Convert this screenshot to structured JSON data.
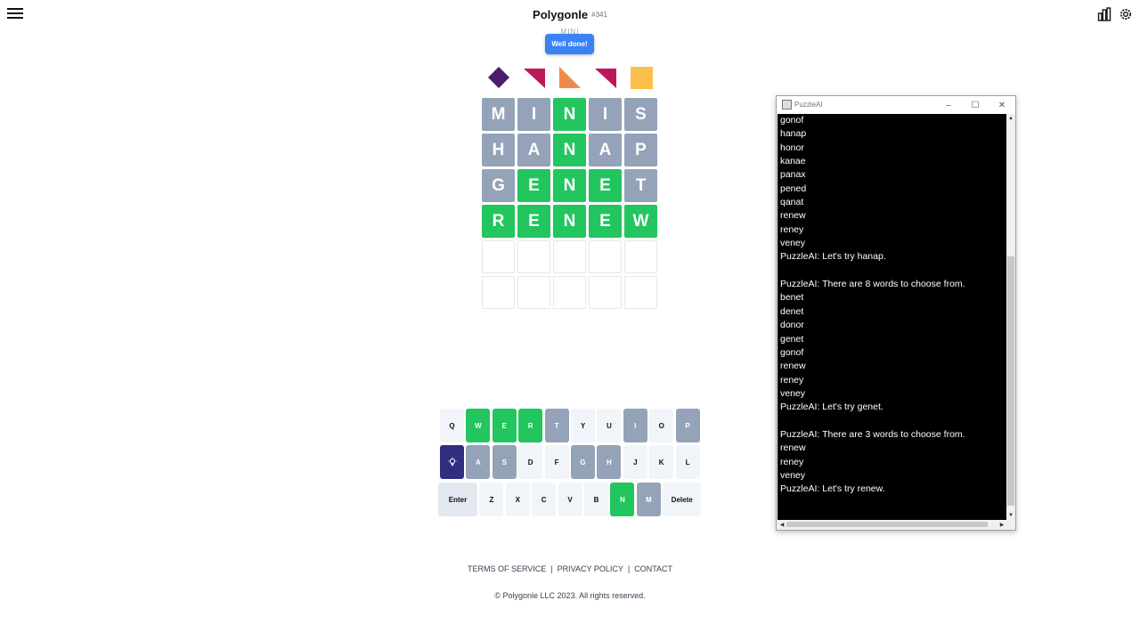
{
  "header": {
    "title": "Polygonle",
    "puzzle_number": "#341",
    "mode": "MINI",
    "toast": "Well done!",
    "menu_icon": "hamburger-icon",
    "stats_icon": "bar-chart-icon",
    "settings_icon": "gear-icon"
  },
  "shapes": [
    {
      "icon": "diamond-shape",
      "color": "#4c1d6b"
    },
    {
      "icon": "triangle-top-right-shape",
      "color": "#be185d"
    },
    {
      "icon": "triangle-bottom-left-shape",
      "color": "#f08a48"
    },
    {
      "icon": "triangle-top-right-shape",
      "color": "#be185d"
    },
    {
      "icon": "square-shape",
      "color": "#fbbf4a"
    }
  ],
  "grid": {
    "rows": [
      [
        {
          "letter": "M",
          "state": "gray"
        },
        {
          "letter": "I",
          "state": "gray"
        },
        {
          "letter": "N",
          "state": "green"
        },
        {
          "letter": "I",
          "state": "gray"
        },
        {
          "letter": "S",
          "state": "gray"
        }
      ],
      [
        {
          "letter": "H",
          "state": "gray"
        },
        {
          "letter": "A",
          "state": "gray"
        },
        {
          "letter": "N",
          "state": "green"
        },
        {
          "letter": "A",
          "state": "gray"
        },
        {
          "letter": "P",
          "state": "gray"
        }
      ],
      [
        {
          "letter": "G",
          "state": "gray"
        },
        {
          "letter": "E",
          "state": "green"
        },
        {
          "letter": "N",
          "state": "green"
        },
        {
          "letter": "E",
          "state": "green"
        },
        {
          "letter": "T",
          "state": "gray"
        }
      ],
      [
        {
          "letter": "R",
          "state": "green"
        },
        {
          "letter": "E",
          "state": "green"
        },
        {
          "letter": "N",
          "state": "green"
        },
        {
          "letter": "E",
          "state": "green"
        },
        {
          "letter": "W",
          "state": "green"
        }
      ],
      [
        {
          "letter": "",
          "state": "empty"
        },
        {
          "letter": "",
          "state": "empty"
        },
        {
          "letter": "",
          "state": "empty"
        },
        {
          "letter": "",
          "state": "empty"
        },
        {
          "letter": "",
          "state": "empty"
        }
      ],
      [
        {
          "letter": "",
          "state": "empty"
        },
        {
          "letter": "",
          "state": "empty"
        },
        {
          "letter": "",
          "state": "empty"
        },
        {
          "letter": "",
          "state": "empty"
        },
        {
          "letter": "",
          "state": "empty"
        }
      ]
    ]
  },
  "keyboard": {
    "rows": [
      [
        {
          "label": "Q",
          "state": "white"
        },
        {
          "label": "W",
          "state": "green"
        },
        {
          "label": "E",
          "state": "green"
        },
        {
          "label": "R",
          "state": "green"
        },
        {
          "label": "T",
          "state": "gray"
        },
        {
          "label": "Y",
          "state": "white"
        },
        {
          "label": "U",
          "state": "white"
        },
        {
          "label": "I",
          "state": "gray"
        },
        {
          "label": "O",
          "state": "white"
        },
        {
          "label": "P",
          "state": "gray"
        }
      ],
      [
        {
          "label": "",
          "state": "hint",
          "icon": "lightbulb-icon"
        },
        {
          "label": "A",
          "state": "gray"
        },
        {
          "label": "S",
          "state": "gray"
        },
        {
          "label": "D",
          "state": "white"
        },
        {
          "label": "F",
          "state": "white"
        },
        {
          "label": "G",
          "state": "gray"
        },
        {
          "label": "H",
          "state": "gray"
        },
        {
          "label": "J",
          "state": "white"
        },
        {
          "label": "K",
          "state": "white"
        },
        {
          "label": "L",
          "state": "white"
        }
      ],
      [
        {
          "label": "Enter",
          "state": "light"
        },
        {
          "label": "Z",
          "state": "white"
        },
        {
          "label": "X",
          "state": "white"
        },
        {
          "label": "C",
          "state": "white"
        },
        {
          "label": "V",
          "state": "white"
        },
        {
          "label": "B",
          "state": "white"
        },
        {
          "label": "N",
          "state": "green"
        },
        {
          "label": "M",
          "state": "gray"
        },
        {
          "label": "Delete",
          "state": "white"
        }
      ]
    ]
  },
  "footer": {
    "links": [
      "TERMS OF SERVICE",
      "PRIVACY POLICY",
      "CONTACT"
    ],
    "separator": "|",
    "copyright": "© Polygonle LLC 2023. All rights reserved."
  },
  "console_window": {
    "title": "PuzzleAI",
    "controls": {
      "minimize": "–",
      "maximize": "☐",
      "close": "✕"
    },
    "lines": [
      "gonof",
      "hanap",
      "honor",
      "kanae",
      "panax",
      "pened",
      "qanat",
      "renew",
      "reney",
      "veney",
      "PuzzleAI: Let's try hanap.",
      "",
      "PuzzleAI: There are 8 words to choose from.",
      "benet",
      "denet",
      "donor",
      "genet",
      "gonof",
      "renew",
      "reney",
      "veney",
      "PuzzleAI: Let's try genet.",
      "",
      "PuzzleAI: There are 3 words to choose from.",
      "renew",
      "reney",
      "veney",
      "PuzzleAI: Let's try renew."
    ]
  }
}
